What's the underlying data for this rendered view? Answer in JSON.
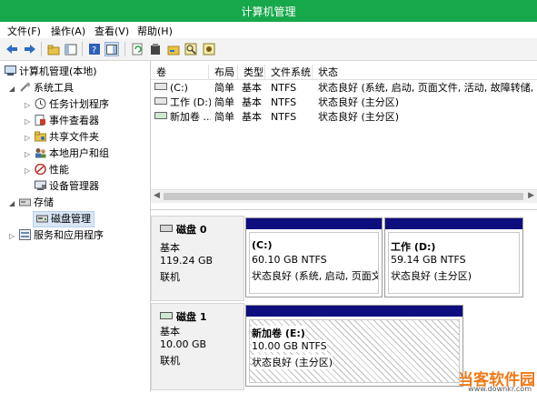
{
  "window": {
    "title": "计算机管理"
  },
  "menu": [
    "文件(F)",
    "操作(A)",
    "查看(V)",
    "帮助(H)"
  ],
  "toolbar_icons": [
    "back-icon",
    "forward-icon",
    "up-folder-icon",
    "console-tree-icon",
    "help-icon",
    "panel-icon",
    "refresh-icon",
    "properties-icon",
    "open-icon",
    "search-icon",
    "settings-icon"
  ],
  "tree": {
    "root": "计算机管理(本地)",
    "system_tools": "系统工具",
    "task_scheduler": "任务计划程序",
    "event_viewer": "事件查看器",
    "shared_folders": "共享文件夹",
    "local_users": "本地用户和组",
    "performance": "性能",
    "device_manager": "设备管理器",
    "storage": "存储",
    "disk_management": "磁盘管理",
    "services": "服务和应用程序"
  },
  "volume_list": {
    "headers": [
      "卷",
      "布局",
      "类型",
      "文件系统",
      "状态"
    ],
    "rows": [
      {
        "volume": "(C:)",
        "layout": "简单",
        "type": "基本",
        "fs": "NTFS",
        "status": "状态良好 (系统, 启动, 页面文件, 活动, 故障转储, 主分"
      },
      {
        "volume": "工作 (D:)",
        "layout": "简单",
        "type": "基本",
        "fs": "NTFS",
        "status": "状态良好 (主分区)"
      },
      {
        "volume": "新加卷 ...",
        "layout": "简单",
        "type": "基本",
        "fs": "NTFS",
        "status": "状态良好 (主分区)"
      }
    ]
  },
  "disks": [
    {
      "name": "磁盘 0",
      "kind": "基本",
      "size": "119.24 GB",
      "state": "联机",
      "partitions": [
        {
          "label": "(C:)",
          "size": "60.10 GB NTFS",
          "status": "状态良好 (系统, 启动, 页面文件"
        },
        {
          "label": "工作  (D:)",
          "size": "59.14 GB NTFS",
          "status": "状态良好 (主分区)"
        }
      ]
    },
    {
      "name": "磁盘 1",
      "kind": "基本",
      "size": "10.00 GB",
      "state": "联机",
      "partitions": [
        {
          "label": "新加卷  (E:)",
          "size": "10.00 GB NTFS",
          "status": "状态良好 (主分区)"
        }
      ]
    }
  ],
  "watermark": {
    "text": "当客软件园",
    "url": "www.downkr.com"
  }
}
